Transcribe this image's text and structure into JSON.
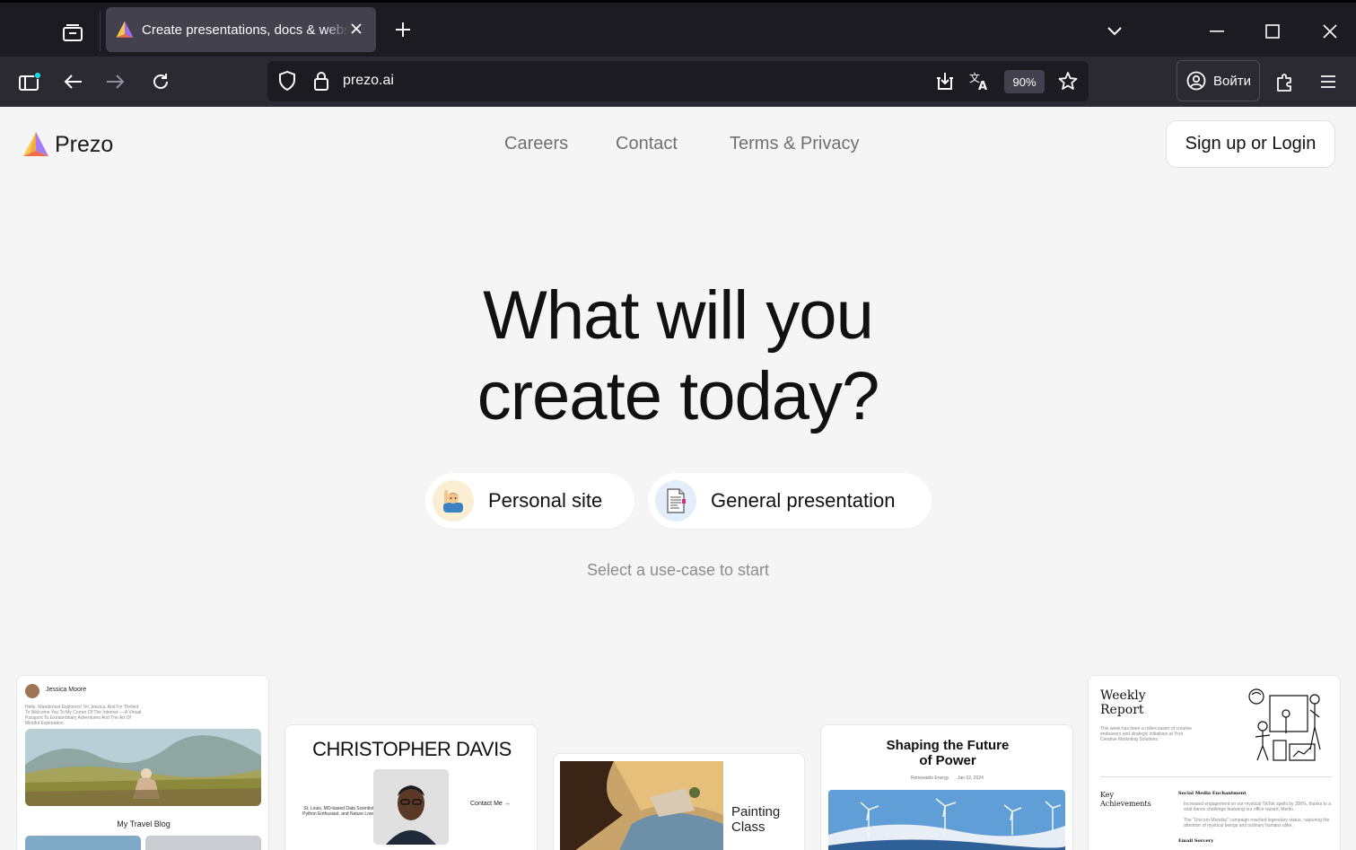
{
  "browser": {
    "tab_title": "Create presentations, docs & websites",
    "url": "prezo.ai",
    "zoom": "90%",
    "login_label": "Войти"
  },
  "site": {
    "logo_text": "Prezo",
    "nav": [
      "Careers",
      "Contact",
      "Terms & Privacy"
    ],
    "signup_label": "Sign up or Login",
    "hero_line1": "What will you",
    "hero_line2": "create today?",
    "use_cases": [
      {
        "label": "Personal site",
        "icon": "person-raising-hand-icon"
      },
      {
        "label": "General presentation",
        "icon": "document-icon"
      }
    ],
    "subtitle": "Select a use-case to start"
  },
  "templates": {
    "travel": {
      "author": "Jessica Moore",
      "intro": "Hello, Wanderlust Explorers! I'm Jessica, And I'm Thrilled To Welcome You To My Corner Of The Internet — A Virtual Passport To Extraordinary Adventures And The Art Of Mindful Exploration.",
      "caption": "My Travel Blog"
    },
    "portfolio": {
      "name": "CHRISTOPHER DAVIS",
      "bio": "St. Louis, MO-based Data Scientist, Python Enthusiast, and Nature Lover",
      "cta": "Contact Me →"
    },
    "painting": {
      "title": "Painting Class"
    },
    "energy": {
      "title": "Shaping the Future of Power",
      "meta_left": "Renewable Energy",
      "meta_right": "Jan 02, 2024"
    },
    "report": {
      "title": "Weekly Report",
      "intro": "This week has been a rollercoaster of creative endeavors and strategic initiatives at Your Creative Marketing Solutions.",
      "section": "Key Achievements",
      "item1_title": "Social Media Enchantment",
      "item1_b1": "Increased engagement on our mystical TikTok spells by 300%, thanks to a viral dance challenge featuring our office wizard, Merlin.",
      "item1_b2": "The \"Unicorn Monday\" campaign reached legendary status, capturing the attention of mystical beings and ordinary humans alike.",
      "item2_title": "Email Sorcery"
    }
  }
}
